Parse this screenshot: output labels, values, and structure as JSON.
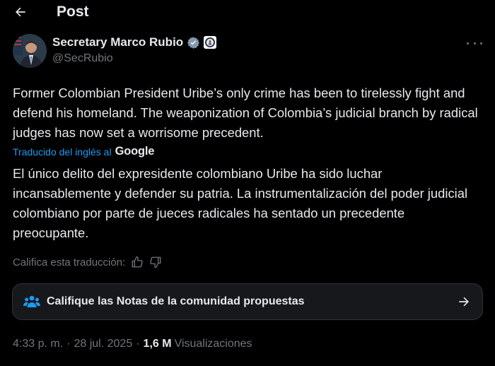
{
  "header": {
    "title": "Post",
    "back_icon": "arrow-left-icon"
  },
  "author": {
    "display_name": "Secretary Marco Rubio",
    "handle": "@SecRubio",
    "verified_badge": "verified-check-icon",
    "affiliation_badge": "government-seal-icon",
    "verified_color": "#829aab"
  },
  "tweet": {
    "text": "Former Colombian President Uribe’s only crime has been to tirelessly fight and defend his homeland. The weaponization of Colombia’s judicial branch by radical judges has now set a worrisome precedent.",
    "translated_by_label": "Traducido del inglés al",
    "translator_brand": "Google",
    "translation": "El único delito del expresidente colombiano Uribe ha sido luchar incansablemente y defender su patria. La instrumentalización del poder judicial colombiano por parte de jueces radicales ha sentado un precedente preocupante.",
    "rate_label": "Califica esta traducción:"
  },
  "community_notes": {
    "label": "Califique las Notas de la comunidad propuestas",
    "icon": "people-icon",
    "arrow_icon": "arrow-right-icon",
    "icon_color": "#1d9bf0"
  },
  "meta": {
    "time": "4:33 p. m.",
    "separator": "·",
    "date": "28 jul. 2025",
    "views_count": "1,6 M",
    "views_label": "Visualizaciones"
  },
  "colors": {
    "background": "#000000",
    "text": "#e7e9ea",
    "muted": "#71767b",
    "link": "#1d9bf0",
    "card": "#16181c",
    "border": "#2f3336"
  }
}
